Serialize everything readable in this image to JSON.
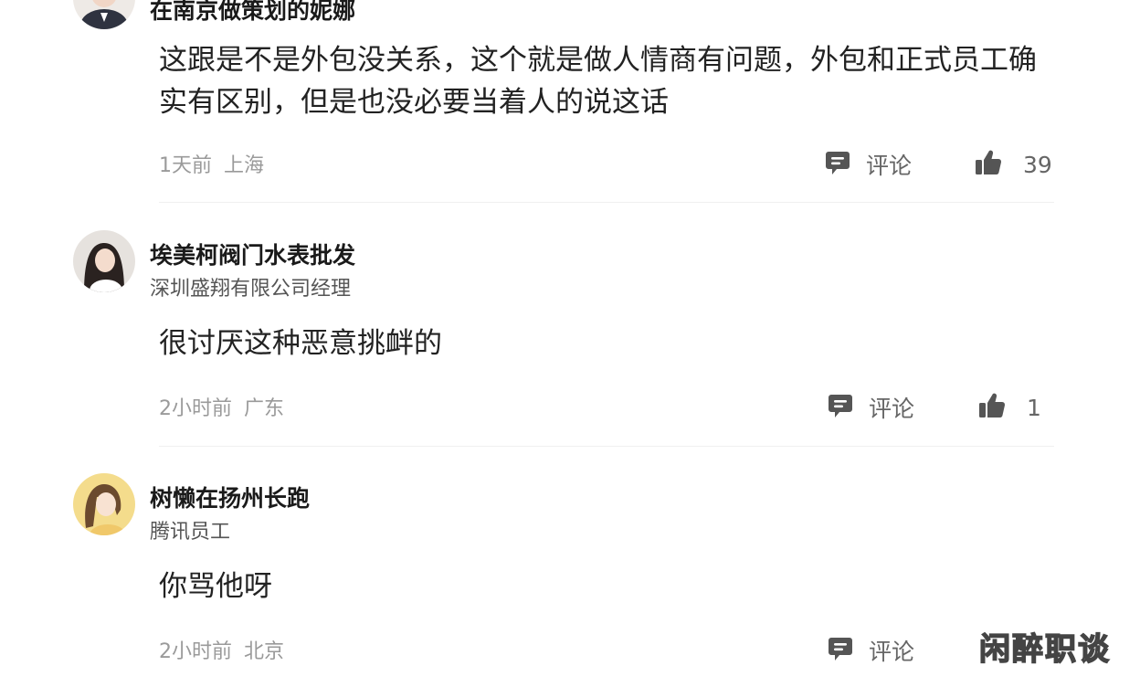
{
  "comments": [
    {
      "username": "在南京做策划的妮娜",
      "subtitle": "",
      "content": "这跟是不是外包没关系，这个就是做人情商有问题，外包和正式员工确实有区别，但是也没必要当着人的说这话",
      "time": "1天前",
      "location": "上海",
      "comment_label": "评论",
      "likes": "39"
    },
    {
      "username": "埃美柯阀门水表批发",
      "subtitle": "深圳盛翔有限公司经理",
      "content": "很讨厌这种恶意挑衅的",
      "time": "2小时前",
      "location": "广东",
      "comment_label": "评论",
      "likes": "1"
    },
    {
      "username": "树懒在扬州长跑",
      "subtitle": "腾讯员工",
      "content": "你骂他呀",
      "time": "2小时前",
      "location": "北京",
      "comment_label": "评论",
      "likes": ""
    }
  ],
  "watermark": "闲醉职谈",
  "icons": {
    "comment": "comment-bubble-icon",
    "like": "thumbs-up-icon"
  },
  "colors": {
    "icon": "#555555",
    "meta_text": "#9a9a9a",
    "username": "#1a1a1a"
  }
}
